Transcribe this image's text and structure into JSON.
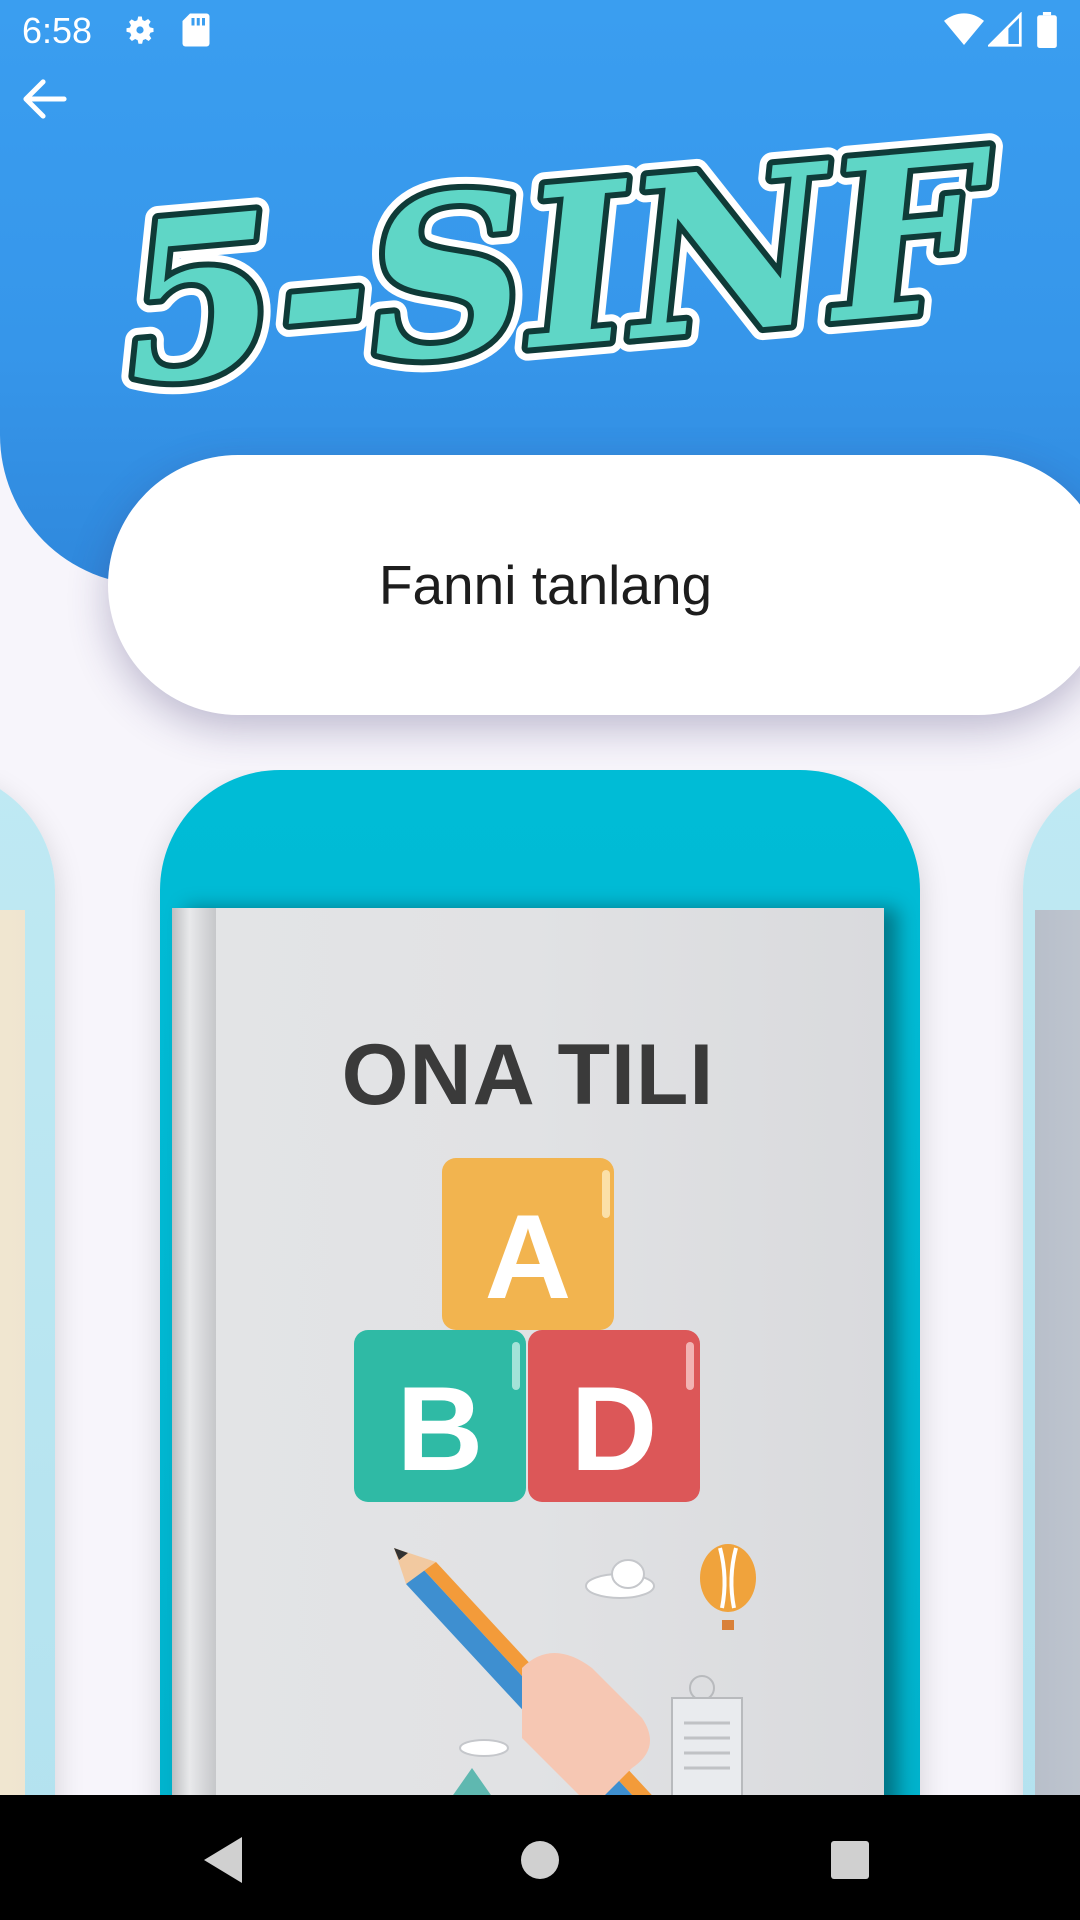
{
  "status_bar": {
    "time": "6:58",
    "left_icons": [
      "gear-icon",
      "sd-card-icon"
    ],
    "right_icons": [
      "wifi-icon",
      "signal-icon",
      "battery-icon"
    ]
  },
  "header": {
    "back_icon": "arrow-left-icon",
    "logo_text": "5-SINF",
    "color": "#3696ea"
  },
  "title_pill": {
    "text": "Fanni tanlang"
  },
  "carousel": {
    "center_card": {
      "book_title": "ONA TILI",
      "blocks": [
        "A",
        "B",
        "D"
      ],
      "accent": "#00bcd6"
    }
  },
  "nav_bar": {
    "buttons": [
      "back-triangle-icon",
      "home-circle-icon",
      "recents-square-icon"
    ]
  }
}
